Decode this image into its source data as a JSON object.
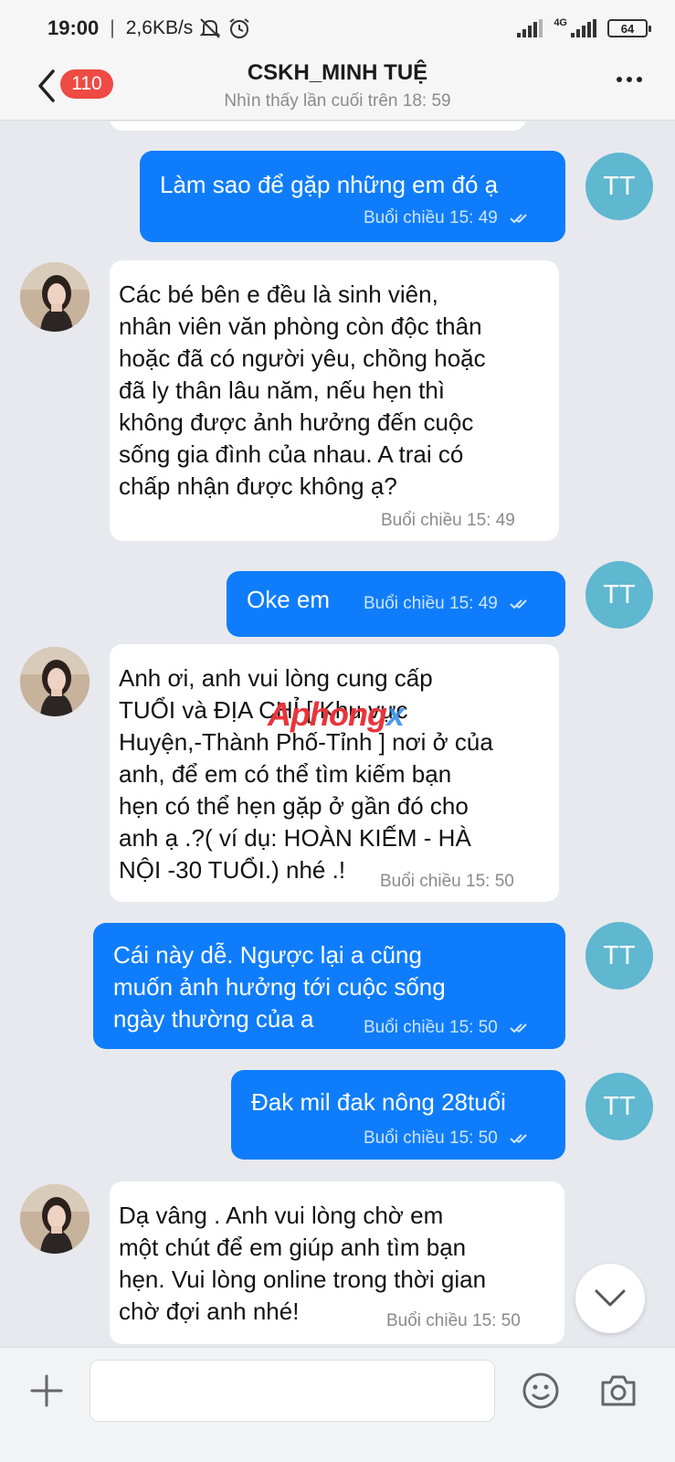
{
  "status_bar": {
    "time": "19:00",
    "net_speed": "2,6KB/s",
    "network_label": "4G",
    "battery": "64",
    "icons": [
      "mute-bell-icon",
      "alarm-icon",
      "signal-icon",
      "battery-icon"
    ]
  },
  "header": {
    "unread_count": "110",
    "title": "CSKH_MINH TUỆ",
    "subtitle": "Nhìn thấy lần cuối trên 18: 59"
  },
  "contact_avatar_initials": "TT",
  "messages": [
    {
      "direction": "out",
      "lines": [
        "Làm sao để gặp những em đó ạ"
      ],
      "time": "Buổi chiều  15: 49",
      "read": true
    },
    {
      "direction": "in",
      "lines": [
        "Các bé bên e đều là sinh viên,",
        "nhân viên văn phòng còn độc thân",
        "hoặc đã có người yêu, chồng hoặc",
        "đã ly thân lâu năm, nếu hẹn thì",
        "không được ảnh hưởng đến cuộc",
        "sống gia đình của nhau. A trai có",
        "chấp nhận được không ạ?"
      ],
      "time": "Buổi chiều  15: 49"
    },
    {
      "direction": "out",
      "lines": [
        "Oke em"
      ],
      "time": "Buổi chiều  15: 49",
      "read": true
    },
    {
      "direction": "in",
      "lines": [
        "Anh ơi, anh vui lòng cung cấp",
        "TUỔI và ĐỊA CHỈ [ Khu vực",
        "Huyện,-Thành Phố-Tỉnh ] nơi ở của",
        "anh, để em có thể tìm kiếm bạn",
        "hẹn có thể hẹn gặp ở gần đó cho",
        "anh ạ .?( ví dụ: HOÀN KIẾM - HÀ",
        "NỘI -30 TUỔI.) nhé .!"
      ],
      "time": "Buổi chiều  15: 50"
    },
    {
      "direction": "out",
      "lines": [
        "Cái này dễ. Ngược lại a cũng",
        "muốn ảnh hưởng tới cuộc sống",
        "ngày thường của a"
      ],
      "time": "Buổi chiều  15: 50",
      "read": true
    },
    {
      "direction": "out",
      "lines": [
        "Đak mil đak nông 28tuổi"
      ],
      "time": "Buổi chiều  15: 50",
      "read": true
    },
    {
      "direction": "in",
      "lines": [
        "Dạ vâng .  Anh vui lòng chờ em",
        "một chút để em giúp anh tìm bạn",
        "hẹn. Vui lòng online trong thời gian",
        "chờ đợi anh nhé!"
      ],
      "time": "Buổi chiều  15: 50"
    }
  ],
  "watermark": {
    "part1": "Aphong",
    "part2": "x"
  },
  "composer": {
    "placeholder": ""
  },
  "colors": {
    "outgoing_bubble": "#0f7dfb",
    "incoming_bubble": "#ffffff",
    "avatar": "#5fb7d0",
    "badge": "#ef4a43"
  }
}
